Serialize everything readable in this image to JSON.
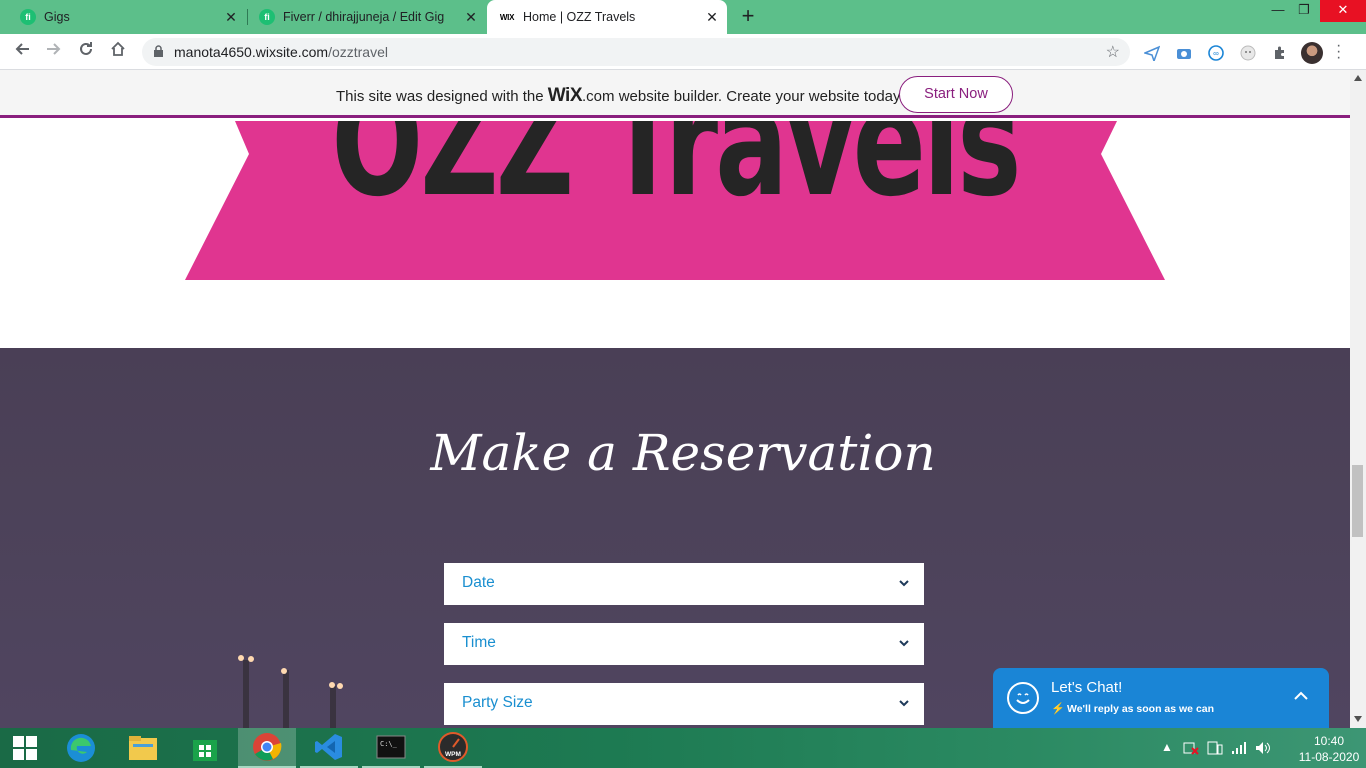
{
  "browser": {
    "tabs": [
      {
        "label": "Gigs",
        "favicon": "fiverr-icon",
        "active": false
      },
      {
        "label": "Fiverr / dhirajjuneja / Edit Gig",
        "favicon": "fiverr-icon",
        "active": false
      },
      {
        "label": "Home | OZZ Travels",
        "favicon": "wix-icon",
        "active": true
      }
    ],
    "favicon_text": {
      "fiverr": "fi",
      "wix": "WIX"
    },
    "url_host": "manota4650.wixsite.com",
    "url_path": "/ozztravel"
  },
  "wix_banner": {
    "prefix": "This site was designed with the",
    "logo": "WiX",
    "logo_suffix": ".com",
    "suffix": "website builder. Create your website today.",
    "button": "Start Now"
  },
  "site": {
    "brand": "OZZ Travels",
    "reservation_title": "Make a Reservation",
    "fields": [
      {
        "label": "Date"
      },
      {
        "label": "Time"
      },
      {
        "label": "Party Size"
      }
    ]
  },
  "chat": {
    "title": "Let's Chat!",
    "subtitle": "We'll reply as soon as we can"
  },
  "taskbar": {
    "time": "10:40",
    "date": "11-08-2020",
    "items": [
      "windows-start",
      "edge",
      "file-explorer",
      "store",
      "chrome",
      "vscode",
      "terminal",
      "wpm"
    ],
    "wpm_label": "WPM",
    "terminal_label": "C:\\_"
  },
  "colors": {
    "tab_strip": "#5cbf8a",
    "ribbon": "#e03590",
    "wix_accent": "#8a1f7e",
    "field_text": "#1a8fd0",
    "chat": "#1a85d6"
  }
}
